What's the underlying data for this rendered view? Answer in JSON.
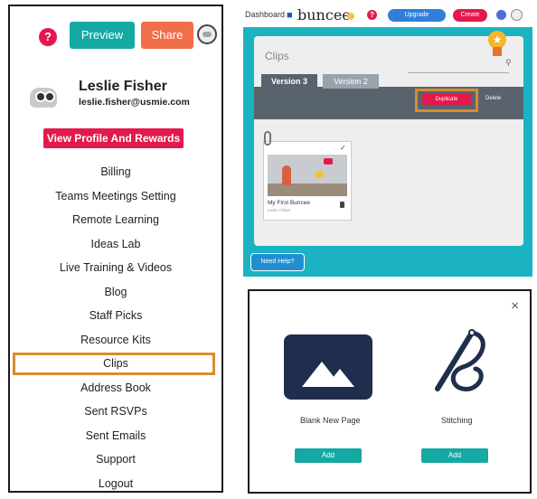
{
  "menu_panel": {
    "preview_label": "Preview",
    "share_label": "Share",
    "help_glyph": "?",
    "user": {
      "name": "Leslie Fisher",
      "email": "leslie.fisher@usmie.com"
    },
    "rewards_label": "View Profile And Rewards",
    "items": [
      {
        "label": "Billing"
      },
      {
        "label": "Teams Meetings Setting"
      },
      {
        "label": "Remote Learning"
      },
      {
        "label": "Ideas Lab"
      },
      {
        "label": "Live Training & Videos"
      },
      {
        "label": "Blog"
      },
      {
        "label": "Staff Picks"
      },
      {
        "label": "Resource Kits"
      },
      {
        "label": "Clips"
      },
      {
        "label": "Address Book"
      },
      {
        "label": "Sent RSVPs"
      },
      {
        "label": "Sent Emails"
      },
      {
        "label": "Support"
      },
      {
        "label": "Logout"
      }
    ],
    "highlighted_item": "Clips",
    "highlight_color": "#d88c2e"
  },
  "app_screen": {
    "nav": {
      "dashboard_label": "Dashboard ▾",
      "logo_text": "buncee",
      "upgrade_label": "Upgrade",
      "create_label": "Create"
    },
    "page_title": "Clips",
    "tabs": [
      {
        "label": "Version 3"
      },
      {
        "label": "Version 2"
      }
    ],
    "duplicate_label": "Duplicate",
    "delete_label": "Delete",
    "clip": {
      "title": "My First Buncee",
      "subtitle": "Leslie Fisher"
    },
    "help_label": "Need Help?",
    "theme_color": "#1bb3c2"
  },
  "dialog": {
    "close_glyph": "×",
    "options": [
      {
        "label": "Blank New Page",
        "add_label": "Add",
        "icon": "image-placeholder-icon"
      },
      {
        "label": "Stitching",
        "add_label": "Add",
        "icon": "needle-thread-icon"
      }
    ]
  },
  "colors": {
    "accent_teal": "#14a9a3",
    "accent_pink": "#e3194d",
    "accent_orange": "#f26d4a",
    "dark_navy": "#1f2e4d"
  }
}
